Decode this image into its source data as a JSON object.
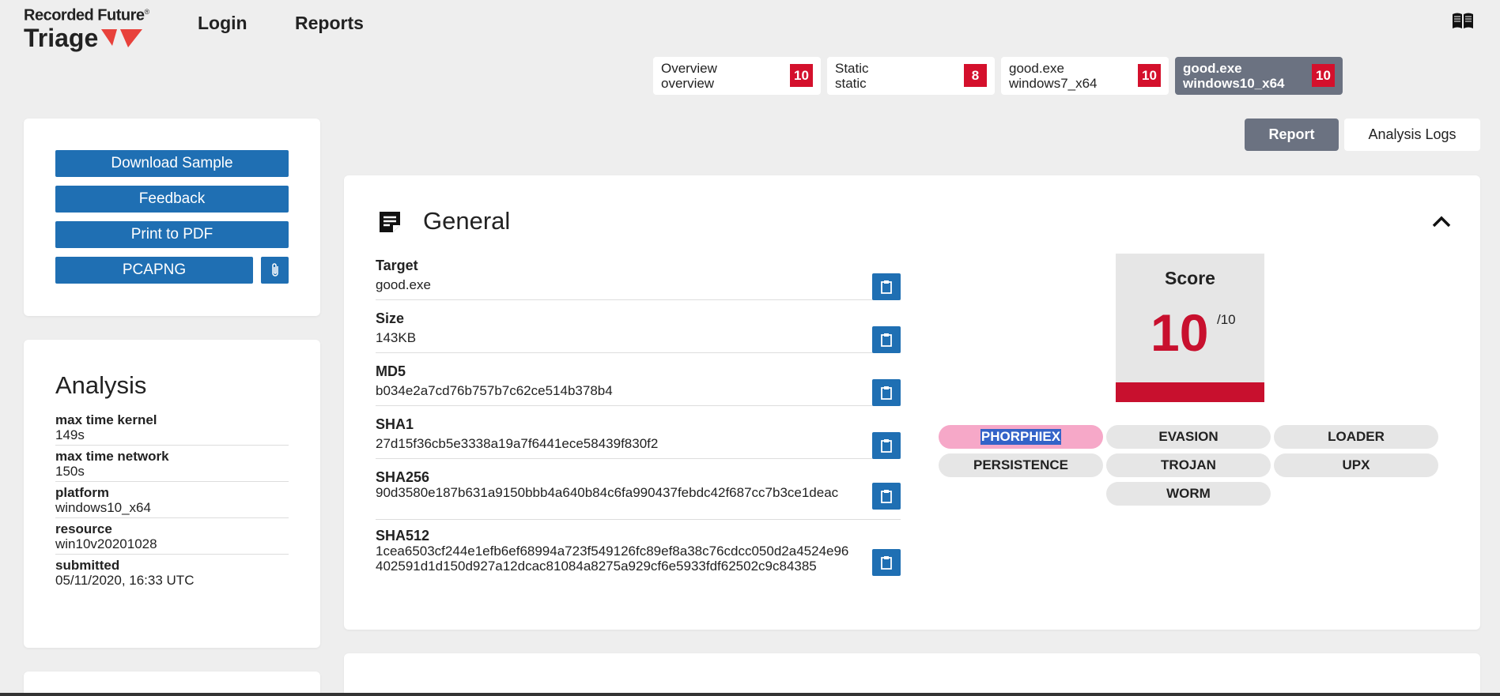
{
  "header": {
    "brand": "Recorded Future",
    "product": "Triage",
    "nav": [
      "Login",
      "Reports"
    ]
  },
  "tabs": [
    {
      "line1": "Overview",
      "line2": "overview",
      "score": "10"
    },
    {
      "line1": "Static",
      "line2": "static",
      "score": "8"
    },
    {
      "line1": "good.exe",
      "line2": "windows7_x64",
      "score": "10"
    },
    {
      "line1": "good.exe",
      "line2": "windows10_x64",
      "score": "10",
      "active": true
    }
  ],
  "view_toggle": {
    "report": "Report",
    "logs": "Analysis Logs"
  },
  "actions": {
    "download": "Download Sample",
    "feedback": "Feedback",
    "print": "Print to PDF",
    "pcap": "PCAPNG"
  },
  "analysis": {
    "title": "Analysis",
    "rows": [
      {
        "key": "max time kernel",
        "value": "149s"
      },
      {
        "key": "max time network",
        "value": "150s"
      },
      {
        "key": "platform",
        "value": "windows10_x64"
      },
      {
        "key": "resource",
        "value": "win10v20201028"
      },
      {
        "key": "submitted",
        "value": "05/11/2020, 16:33 UTC"
      }
    ]
  },
  "general": {
    "title": "General",
    "fields": [
      {
        "key": "Target",
        "value": "good.exe"
      },
      {
        "key": "Size",
        "value": "143KB"
      },
      {
        "key": "MD5",
        "value": "b034e2a7cd76b757b7c62ce514b378b4"
      },
      {
        "key": "SHA1",
        "value": "27d15f36cb5e3338a19a7f6441ece58439f830f2"
      },
      {
        "key": "SHA256",
        "value": "90d3580e187b631a9150bbb4a640b84c6fa990437febdc42f687cc7b3ce1deac"
      },
      {
        "key": "SHA512",
        "value": "1cea6503cf244e1efb6ef68994a723f549126fc89ef8a38c76cdcc050d2a4524e96402591d1d150d927a12dcac81084a8275a929cf6e5933fdf62502c9c84385"
      }
    ],
    "score": {
      "label": "Score",
      "value": "10",
      "max": "/10"
    },
    "tags": [
      "PHORPHIEX",
      "EVASION",
      "LOADER",
      "PERSISTENCE",
      "TROJAN",
      "UPX",
      "WORM"
    ]
  },
  "colors": {
    "accent": "#1f6fb3",
    "danger": "#c8102e",
    "active_tab": "#6b7281"
  }
}
